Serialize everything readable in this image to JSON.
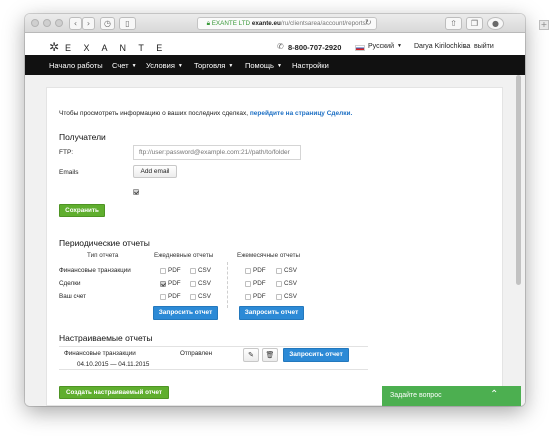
{
  "browser": {
    "address": {
      "secure": "EXANTE LTD",
      "host": "exante.eu",
      "path": "/ru/clientsarea/account/reports/"
    },
    "icons": [
      "back-icon",
      "forward-icon",
      "history-icon",
      "sidebar-icon",
      "reload-icon",
      "share-icon",
      "tabs-icon",
      "extension-icon",
      "new-tab-icon"
    ]
  },
  "header": {
    "logo_text": "E X A N T E",
    "phone": "8-800-707-2920",
    "language": "Русский",
    "user": "Darya Kirilochkina",
    "logout": "выйти"
  },
  "nav": {
    "items": [
      {
        "label": "Начало работы",
        "dropdown": false
      },
      {
        "label": "Счет",
        "dropdown": true
      },
      {
        "label": "Условия",
        "dropdown": true
      },
      {
        "label": "Торговля",
        "dropdown": true
      },
      {
        "label": "Помощь",
        "dropdown": true
      },
      {
        "label": "Настройки",
        "dropdown": false
      }
    ],
    "caret": "▼"
  },
  "info": {
    "text": "Чтобы просмотреть информацию о ваших последних сделках,",
    "link": "перейдите на страницу Сделки."
  },
  "recipients": {
    "title": "Получатели",
    "ftp_label": "FTP:",
    "ftp_placeholder": "ftp://user:password@example.com:21//path/to/folder",
    "emails_label": "Emails",
    "add_email": "Add email",
    "save": "Сохранить"
  },
  "periodic": {
    "title": "Периодические отчеты",
    "col_type": "Тип отчета",
    "col_daily": "Ежедневные отчеты",
    "col_monthly": "Ежемесячные отчеты",
    "pdf": "PDF",
    "csv": "CSV",
    "rows": [
      {
        "label": "Финансовые транзакции",
        "daily_pdf": false,
        "daily_csv": false,
        "monthly_pdf": false,
        "monthly_csv": false
      },
      {
        "label": "Сделки",
        "daily_pdf": true,
        "daily_csv": false,
        "monthly_pdf": false,
        "monthly_csv": false
      },
      {
        "label": "Ваш счет",
        "daily_pdf": false,
        "daily_csv": false,
        "monthly_pdf": false,
        "monthly_csv": false
      }
    ],
    "request": "Запросить отчет"
  },
  "custom": {
    "title": "Настраиваемые отчеты",
    "row": {
      "name": "Финансовые транзакции",
      "period": "04.10.2015 — 04.11.2015",
      "status": "Отправлен"
    },
    "request": "Запросить отчет",
    "create": "Создать настраиваемый отчет"
  },
  "chat": {
    "label": "Задайте вопрос"
  }
}
